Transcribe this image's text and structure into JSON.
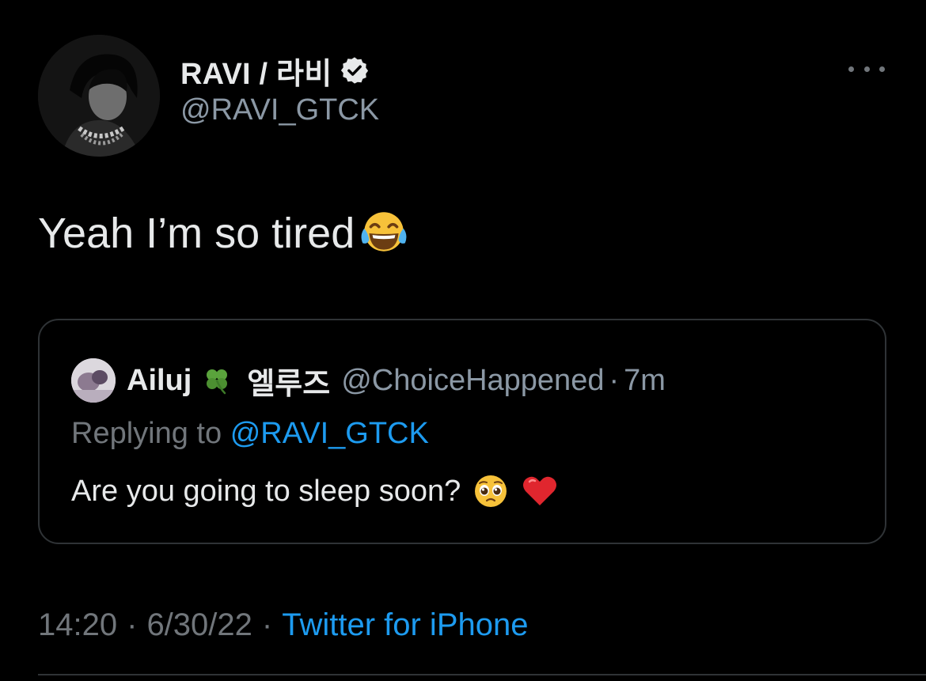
{
  "author": {
    "display_name": "RAVI / 라비",
    "handle": "@RAVI_GTCK",
    "verified": true,
    "avatar_icon": "profile-photo"
  },
  "more_icon": "more-horizontal-icon",
  "tweet": {
    "text": "Yeah I’m so tired",
    "emoji": "face-with-tears-of-joy"
  },
  "quote": {
    "author_name": "Ailuj",
    "name_emoji": "four-leaf-clover",
    "author_name_ko": "엘루즈",
    "handle": "@ChoiceHappened",
    "separator": "·",
    "time": "7m",
    "replying_prefix": "Replying to",
    "replying_to": "@RAVI_GTCK",
    "text": "Are you going to sleep soon?",
    "emojis": [
      "pleading-face",
      "red-heart"
    ]
  },
  "meta": {
    "time": "14:20",
    "separator": "·",
    "date": "6/30/22",
    "source": "Twitter for iPhone"
  },
  "colors": {
    "background": "#000000",
    "text_primary": "#e7e9ea",
    "text_secondary": "#71767b",
    "link": "#1d9bf0",
    "border": "#2f3336"
  }
}
